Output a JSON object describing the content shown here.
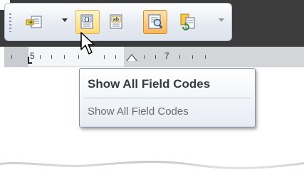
{
  "toolbar": {
    "buttons": [
      {
        "icon": "insert-field-icon",
        "label": "Insert Field",
        "state": "normal",
        "has_dropdown": true
      },
      {
        "icon": "field-code-icon",
        "label": "Show All Field Codes",
        "state": "hover"
      },
      {
        "icon": "field-results-icon",
        "label": "Show All Field Results",
        "state": "normal"
      },
      {
        "icon": "highlight-fields-icon",
        "label": "Highlight Fields",
        "state": "pressed"
      },
      {
        "icon": "update-fields-icon",
        "label": "Update Fields",
        "state": "normal",
        "has_dropdown": true
      }
    ],
    "glyphs": {
      "field_code": "{}",
      "field_result": "ab"
    }
  },
  "ruler": {
    "numbers": [
      "5",
      "7"
    ],
    "colors": {
      "margin": "#c9ccd1",
      "text_area": "#f4f5f7"
    }
  },
  "tooltip": {
    "title": "Show All Field Codes",
    "description": "Show All Field Codes"
  },
  "colors": {
    "hover_button": "#ffd978",
    "pressed_button": "#f8b65a",
    "frame": "#3c3c3c",
    "toolbar": "#e7ebf2"
  }
}
